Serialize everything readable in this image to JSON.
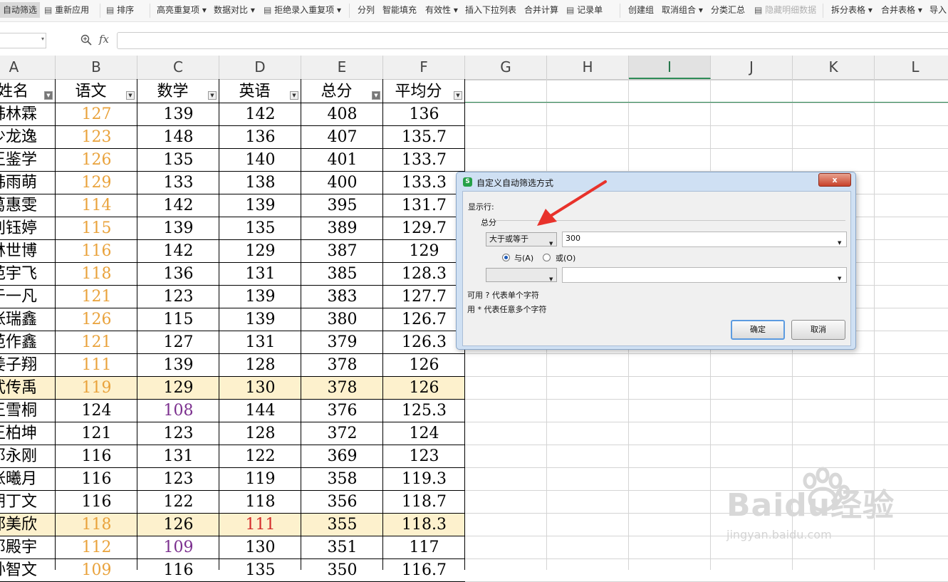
{
  "toolbar": {
    "items": [
      {
        "label": "自动筛选",
        "state": "active"
      },
      {
        "label": "重新应用",
        "icon": "reapply-filter-icon"
      },
      {
        "label": "排序",
        "icon": "sort-icon"
      },
      {
        "label": "高亮重复项 ▾"
      },
      {
        "label": "数据对比 ▾"
      },
      {
        "label": "拒绝录入重复项 ▾",
        "icon": "reject-duplicates-icon"
      },
      {
        "label": "分列"
      },
      {
        "label": "智能填充"
      },
      {
        "label": "有效性 ▾"
      },
      {
        "label": "插入下拉列表"
      },
      {
        "label": "合并计算"
      },
      {
        "label": "记录单",
        "icon": "record-form-icon"
      },
      {
        "label": "创建组"
      },
      {
        "label": "取消组合 ▾"
      },
      {
        "label": "分类汇总"
      },
      {
        "label": "隐藏明细数据",
        "state": "disabled",
        "icon": "hide-detail-icon"
      },
      {
        "label": "拆分表格 ▾"
      },
      {
        "label": "合并表格 ▾"
      },
      {
        "label": "导入"
      }
    ]
  },
  "formula_bar": {
    "fx_label": "fx",
    "value": ""
  },
  "columns": [
    "A",
    "B",
    "C",
    "D",
    "E",
    "F",
    "G",
    "H",
    "I",
    "J",
    "K",
    "L"
  ],
  "selected_column": "I",
  "table": {
    "headers": [
      "姓名",
      "语文",
      "数学",
      "英语",
      "总分",
      "平均分"
    ],
    "filtered_headers": [
      "姓名"
    ],
    "active_filter_header": "总分",
    "rows": [
      [
        "韩林霖",
        "127",
        "139",
        "142",
        "408",
        "136"
      ],
      [
        "少龙逸",
        "123",
        "148",
        "136",
        "407",
        "135.7"
      ],
      [
        "王鉴学",
        "126",
        "135",
        "140",
        "401",
        "133.7"
      ],
      [
        "韩雨萌",
        "129",
        "133",
        "138",
        "400",
        "133.3"
      ],
      [
        "葛惠雯",
        "114",
        "142",
        "139",
        "395",
        "131.7"
      ],
      [
        "刘钰婷",
        "115",
        "139",
        "135",
        "389",
        "129.7"
      ],
      [
        "林世博",
        "116",
        "142",
        "129",
        "387",
        "129"
      ],
      [
        "范宇飞",
        "118",
        "136",
        "131",
        "385",
        "128.3"
      ],
      [
        "于一凡",
        "121",
        "123",
        "139",
        "383",
        "127.7"
      ],
      [
        "张瑞鑫",
        "126",
        "115",
        "139",
        "380",
        "126.7"
      ],
      [
        "范作鑫",
        "121",
        "127",
        "131",
        "379",
        "126.3"
      ],
      [
        "姜子翔",
        "111",
        "139",
        "128",
        "378",
        "126"
      ],
      [
        "武传禹",
        "119",
        "129",
        "130",
        "378",
        "126"
      ],
      [
        "王雪桐",
        "124",
        "108",
        "144",
        "376",
        "125.3"
      ],
      [
        "王柏坤",
        "121",
        "123",
        "128",
        "372",
        "124"
      ],
      [
        "邓永刚",
        "116",
        "131",
        "122",
        "369",
        "123"
      ],
      [
        "张曦月",
        "116",
        "123",
        "119",
        "358",
        "119.3"
      ],
      [
        "胡丁文",
        "116",
        "122",
        "118",
        "356",
        "118.7"
      ],
      [
        "邵美欣",
        "118",
        "126",
        "111",
        "355",
        "118.3"
      ],
      [
        "邓殿宇",
        "112",
        "109",
        "130",
        "351",
        "117"
      ],
      [
        "孙智文",
        "109",
        "116",
        "135",
        "350",
        "116.7"
      ]
    ],
    "highlighted_rows": [
      12,
      18
    ],
    "colors": {
      "orange": "#e9a23b",
      "purple": "#7b2f8e",
      "red": "#d42a2a",
      "highlight": "#fdf1cd"
    },
    "cell_colors": [
      [
        0,
        1,
        "orange"
      ],
      [
        1,
        1,
        "orange"
      ],
      [
        2,
        1,
        "orange"
      ],
      [
        3,
        1,
        "orange"
      ],
      [
        4,
        1,
        "orange"
      ],
      [
        5,
        1,
        "orange"
      ],
      [
        6,
        1,
        "orange"
      ],
      [
        7,
        1,
        "orange"
      ],
      [
        8,
        1,
        "orange"
      ],
      [
        9,
        1,
        "orange"
      ],
      [
        10,
        1,
        "orange"
      ],
      [
        11,
        1,
        "orange"
      ],
      [
        12,
        1,
        "orange"
      ],
      [
        13,
        2,
        "purple"
      ],
      [
        18,
        1,
        "orange"
      ],
      [
        18,
        3,
        "red"
      ],
      [
        19,
        1,
        "orange"
      ],
      [
        19,
        2,
        "purple"
      ],
      [
        20,
        1,
        "orange"
      ]
    ]
  },
  "dialog": {
    "title": "自定义自动筛选方式",
    "close_label": "x",
    "show_rows_label": "显示行:",
    "field_label": "总分",
    "condition1": {
      "operator": "大于或等于",
      "value": "300"
    },
    "logic_and_label": "与(A)",
    "logic_or_label": "或(O)",
    "logic_selected": "and",
    "condition2": {
      "operator": "",
      "value": ""
    },
    "hint1": "可用 ? 代表单个字符",
    "hint2": "用 * 代表任意多个字符",
    "ok_label": "确定",
    "cancel_label": "取消"
  },
  "watermark": {
    "brand": "Baidu经验",
    "url": "jingyan.baidu.com"
  }
}
